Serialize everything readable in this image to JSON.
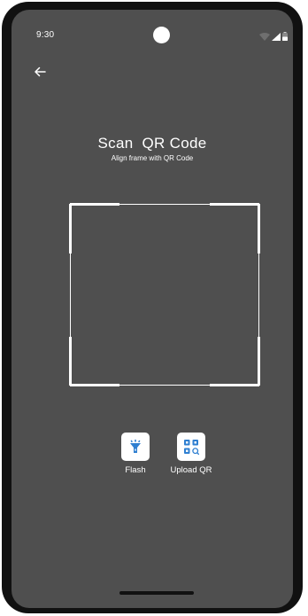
{
  "status_bar": {
    "time": "9:30",
    "icons": [
      "wifi-icon",
      "signal-icon",
      "battery-icon"
    ]
  },
  "header": {
    "back_icon": "arrow-left-icon"
  },
  "main": {
    "title": "Scan  QR Code",
    "subtitle": "Align frame with QR Code"
  },
  "actions": [
    {
      "label": "Flash",
      "icon": "flashlight-icon"
    },
    {
      "label": "Upload QR",
      "icon": "qr-code-icon"
    }
  ],
  "colors": {
    "screen_background": "#4f4f4f",
    "device_frame": "#111111",
    "text": "#ffffff",
    "icon_accent": "#2f7fd1"
  }
}
